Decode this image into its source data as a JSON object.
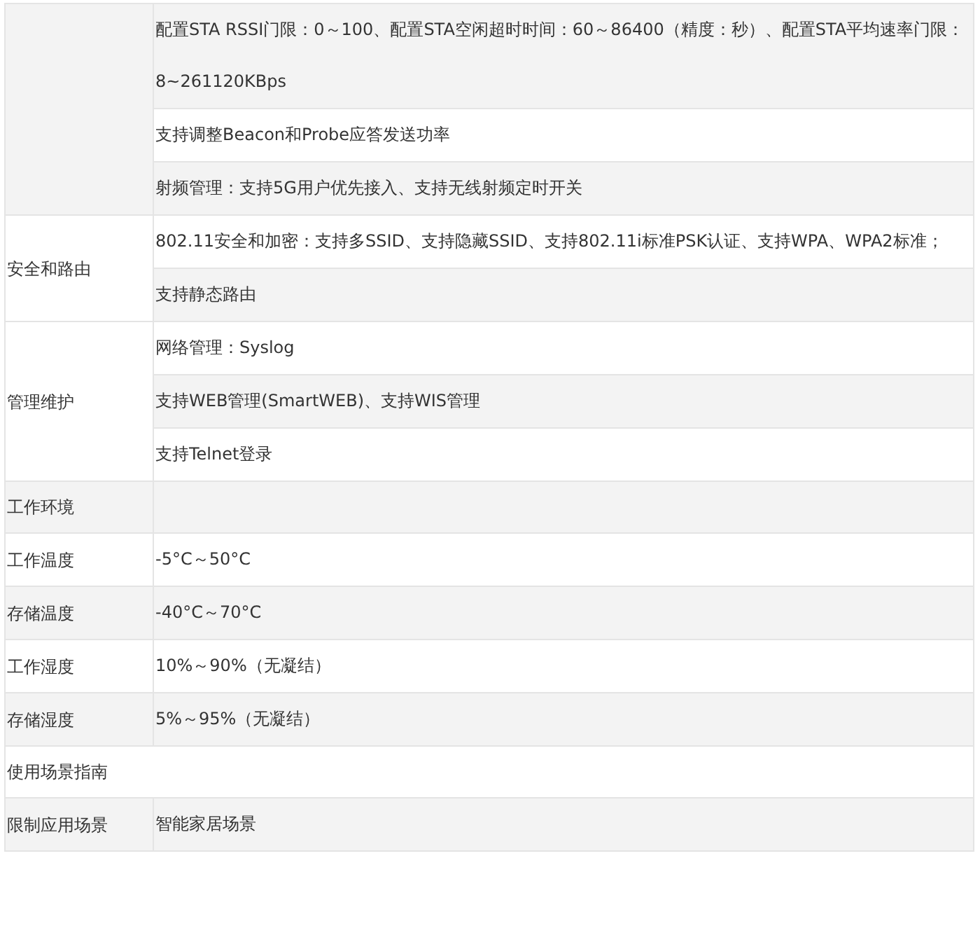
{
  "spec_table": {
    "rows": [
      {
        "kind": "group",
        "shaded": true,
        "items": [
          {
            "text": "配置STA RSSI门限：0～100、配置STA空闲超时时间：60～86400（精度：秒）、配置STA平均速率门限：8~261120KBps",
            "shaded": true
          },
          {
            "text": "支持调整Beacon和Probe应答发送功率",
            "shaded": false
          },
          {
            "text": "射频管理：支持5G用户优先接入、支持无线射频定时开关",
            "shaded": true
          }
        ]
      },
      {
        "kind": "group",
        "label": "安全和路由",
        "shaded": false,
        "items": [
          {
            "text": "802.11安全和加密：支持多SSID、支持隐藏SSID、支持802.11i标准PSK认证、支持WPA、WPA2标准；",
            "shaded": false
          },
          {
            "text": "支持静态路由",
            "shaded": true
          }
        ]
      },
      {
        "kind": "group",
        "label": "管理维护",
        "shaded": false,
        "items": [
          {
            "text": "网络管理：Syslog",
            "shaded": false
          },
          {
            "text": "支持WEB管理(SmartWEB)、支持WIS管理",
            "shaded": true
          },
          {
            "text": "支持Telnet登录",
            "shaded": false
          }
        ]
      },
      {
        "kind": "pair",
        "label": "工作环境",
        "shaded": true
      },
      {
        "kind": "pair",
        "label": "工作温度",
        "value": "-5°C～50°C",
        "shaded": false
      },
      {
        "kind": "pair",
        "label": "存储温度",
        "value": "-40°C～70°C",
        "shaded": true
      },
      {
        "kind": "pair",
        "label": "工作湿度",
        "value": "10%～90%（无凝结）",
        "shaded": false
      },
      {
        "kind": "pair",
        "label": "存储湿度",
        "value": "5%～95%（无凝结）",
        "shaded": true
      },
      {
        "kind": "heading",
        "label": "使用场景指南",
        "shaded": false
      },
      {
        "kind": "pair",
        "label": "限制应用场景",
        "value": "智能家居场景",
        "shaded": true
      }
    ]
  }
}
